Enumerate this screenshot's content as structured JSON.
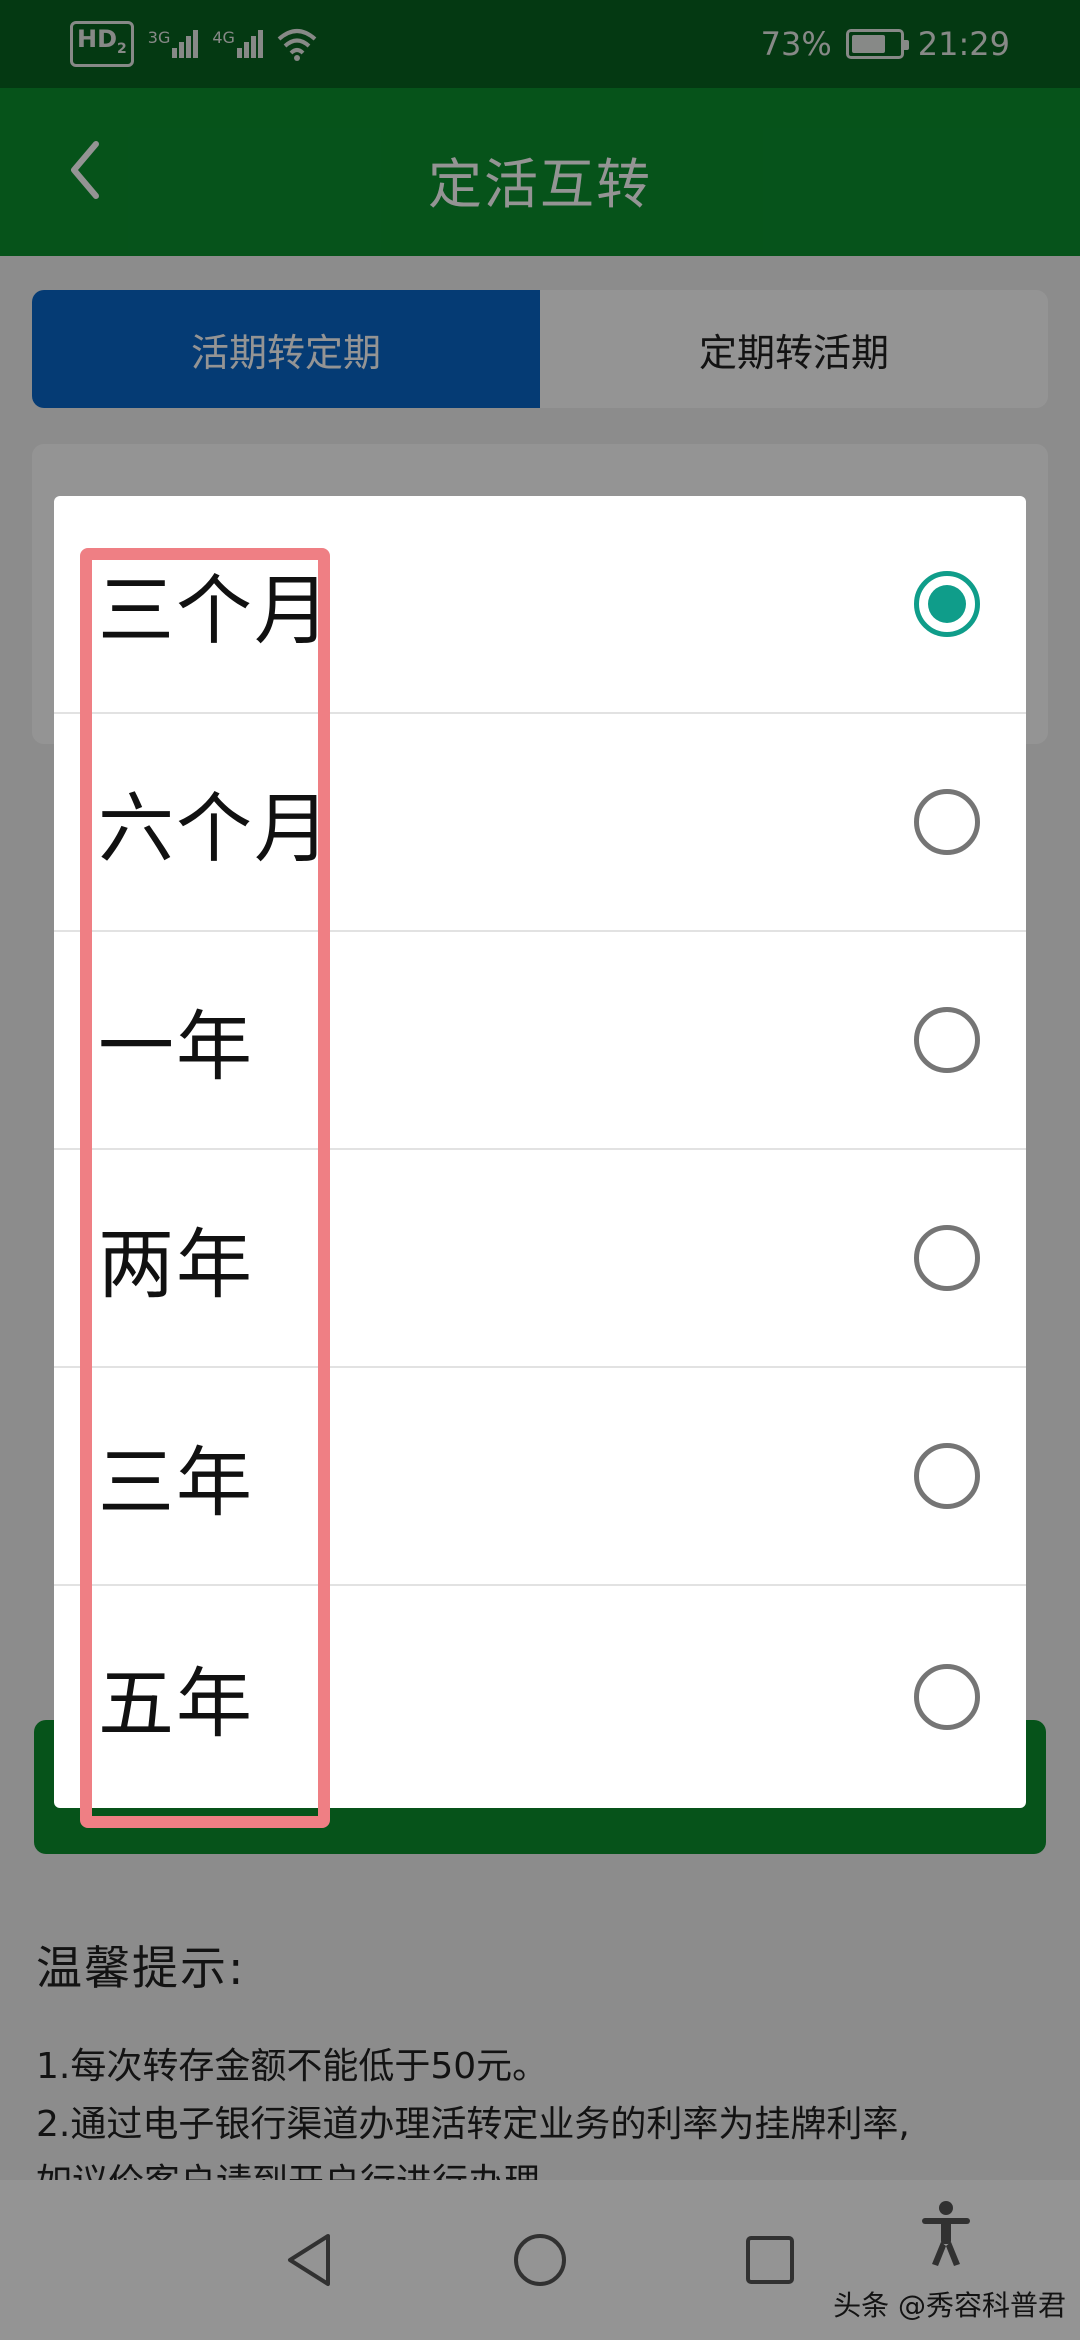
{
  "status_bar": {
    "hd_badge": "HD",
    "sim": "2",
    "net_1": "3G",
    "net_2": "4G",
    "battery": "73%",
    "battery_level": 0.73,
    "time": "21:29"
  },
  "header": {
    "title": "定活互转",
    "back_icon": "chevron-left-icon"
  },
  "tabs": [
    {
      "label": "活期转定期",
      "active": true
    },
    {
      "label": "定期转活期",
      "active": false
    }
  ],
  "tips": {
    "title": "温馨提示:",
    "line_1": "1.每次转存金额不能低于50元。",
    "line_2": "2.通过电子银行渠道办理活转定业务的利率为挂牌利率,",
    "line_3": "如议价客户请到开户行进行办理。"
  },
  "dialog": {
    "options": [
      {
        "label": "三个月",
        "selected": true
      },
      {
        "label": "六个月",
        "selected": false
      },
      {
        "label": "一年",
        "selected": false
      },
      {
        "label": "两年",
        "selected": false
      },
      {
        "label": "三年",
        "selected": false
      },
      {
        "label": "五年",
        "selected": false
      }
    ]
  },
  "nav": {
    "back_icon": "triangle-back-icon",
    "home_icon": "circle-home-icon",
    "recents_icon": "square-recents-icon",
    "accessibility_icon": "accessibility-icon"
  },
  "watermark": "头条 @秀容科普君",
  "colors": {
    "header_green": "#0b8f2e",
    "tab_blue": "#0a66c8",
    "radio_teal": "#0f9d8a",
    "annotation_red": "#ef7f84"
  }
}
